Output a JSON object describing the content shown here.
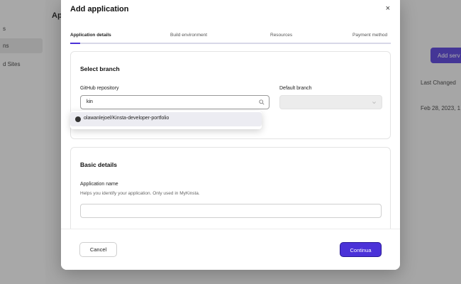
{
  "background": {
    "title": "Ap",
    "sidebar": [
      "s",
      "ns",
      "d Sites"
    ],
    "add_button": "Add serv",
    "column_header": "Last Changed",
    "date": "Feb 28, 2023, 1"
  },
  "modal": {
    "title": "Add application",
    "close": "×",
    "steps": [
      "Application details",
      "Build environment",
      "Resources",
      "Payment method"
    ],
    "progress_fraction": 0.03,
    "accent": "#4b32d8"
  },
  "select_branch": {
    "title": "Select branch",
    "repo_label": "GitHub repository",
    "repo_value": "kin",
    "branch_label": "Default branch",
    "branch_value": "",
    "dropdown_option": "olawanlejoel/Kinsta-developer-portfolio"
  },
  "basic_details": {
    "title": "Basic details",
    "app_name_label": "Application name",
    "app_name_helper": "Helps you identify your application. Only used in MyKinsta.",
    "app_name_value": ""
  },
  "footer": {
    "cancel": "Cancel",
    "continue": "Continua"
  }
}
